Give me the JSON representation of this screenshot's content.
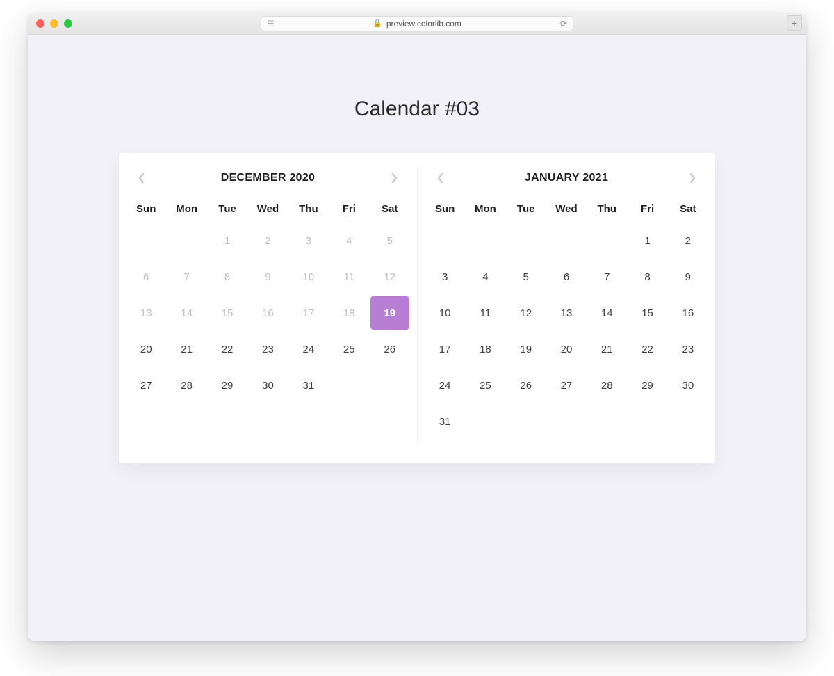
{
  "browser": {
    "url_text": "preview.colorlib.com"
  },
  "page": {
    "heading": "Calendar #03"
  },
  "weekdays": [
    "Sun",
    "Mon",
    "Tue",
    "Wed",
    "Thu",
    "Fri",
    "Sat"
  ],
  "calendars": [
    {
      "title": "DECEMBER 2020",
      "today": 19,
      "weeks": [
        [
          {
            "d": null
          },
          {
            "d": null
          },
          {
            "d": 1,
            "past": true
          },
          {
            "d": 2,
            "past": true
          },
          {
            "d": 3,
            "past": true
          },
          {
            "d": 4,
            "past": true
          },
          {
            "d": 5,
            "past": true
          }
        ],
        [
          {
            "d": 6,
            "past": true
          },
          {
            "d": 7,
            "past": true
          },
          {
            "d": 8,
            "past": true
          },
          {
            "d": 9,
            "past": true
          },
          {
            "d": 10,
            "past": true
          },
          {
            "d": 11,
            "past": true
          },
          {
            "d": 12,
            "past": true
          }
        ],
        [
          {
            "d": 13,
            "past": true
          },
          {
            "d": 14,
            "past": true
          },
          {
            "d": 15,
            "past": true
          },
          {
            "d": 16,
            "past": true
          },
          {
            "d": 17,
            "past": true
          },
          {
            "d": 18,
            "past": true
          },
          {
            "d": 19,
            "today": true
          }
        ],
        [
          {
            "d": 20
          },
          {
            "d": 21
          },
          {
            "d": 22
          },
          {
            "d": 23
          },
          {
            "d": 24
          },
          {
            "d": 25
          },
          {
            "d": 26
          }
        ],
        [
          {
            "d": 27
          },
          {
            "d": 28
          },
          {
            "d": 29
          },
          {
            "d": 30
          },
          {
            "d": 31
          },
          {
            "d": null
          },
          {
            "d": null
          }
        ]
      ]
    },
    {
      "title": "JANUARY 2021",
      "today": null,
      "weeks": [
        [
          {
            "d": null
          },
          {
            "d": null
          },
          {
            "d": null
          },
          {
            "d": null
          },
          {
            "d": null
          },
          {
            "d": 1
          },
          {
            "d": 2
          }
        ],
        [
          {
            "d": 3
          },
          {
            "d": 4
          },
          {
            "d": 5
          },
          {
            "d": 6
          },
          {
            "d": 7
          },
          {
            "d": 8
          },
          {
            "d": 9
          }
        ],
        [
          {
            "d": 10
          },
          {
            "d": 11
          },
          {
            "d": 12
          },
          {
            "d": 13
          },
          {
            "d": 14
          },
          {
            "d": 15
          },
          {
            "d": 16
          }
        ],
        [
          {
            "d": 17
          },
          {
            "d": 18
          },
          {
            "d": 19
          },
          {
            "d": 20
          },
          {
            "d": 21
          },
          {
            "d": 22
          },
          {
            "d": 23
          }
        ],
        [
          {
            "d": 24
          },
          {
            "d": 25
          },
          {
            "d": 26
          },
          {
            "d": 27
          },
          {
            "d": 28
          },
          {
            "d": 29
          },
          {
            "d": 30
          }
        ],
        [
          {
            "d": 31
          },
          {
            "d": null
          },
          {
            "d": null
          },
          {
            "d": null
          },
          {
            "d": null
          },
          {
            "d": null
          },
          {
            "d": null
          }
        ]
      ]
    }
  ]
}
